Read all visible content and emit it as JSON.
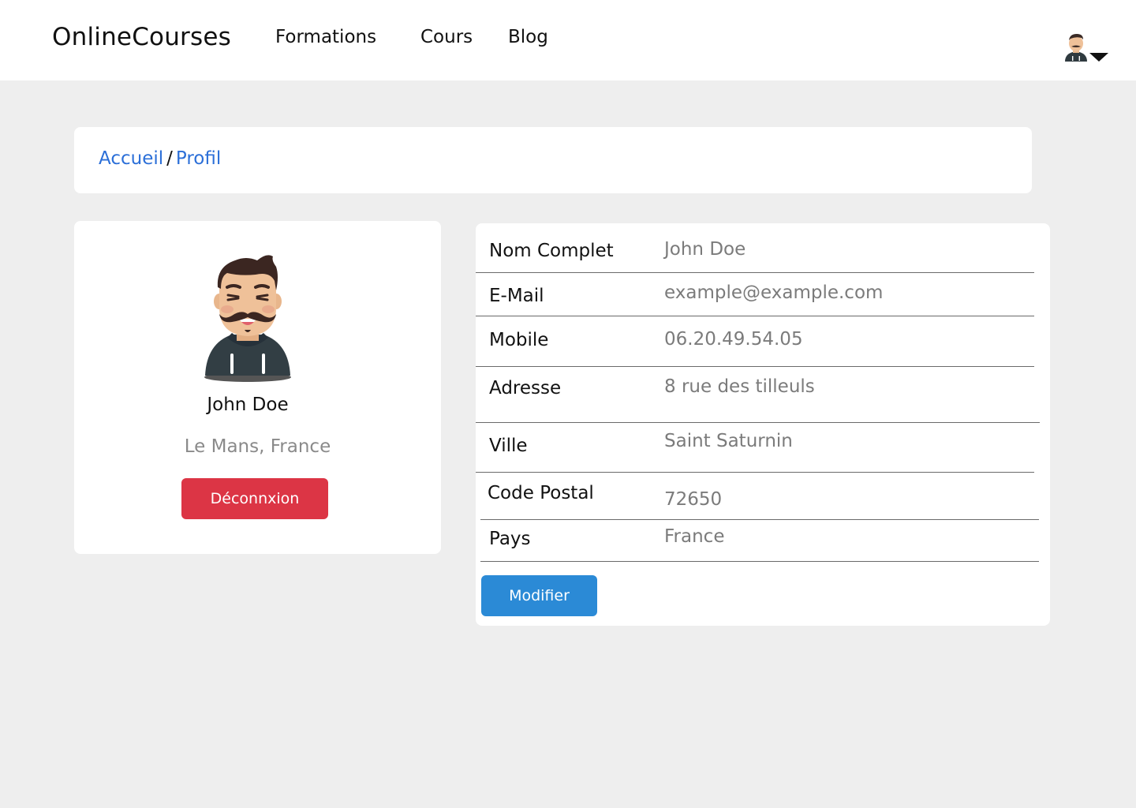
{
  "navbar": {
    "brand": "OnlineCourses",
    "links": [
      "Formations",
      "Cours",
      "Blog"
    ],
    "user_menu_icon": "user-avatar-icon",
    "dropdown_icon": "caret-down-icon"
  },
  "breadcrumb": {
    "home": "Accueil",
    "separator": "/",
    "current": "Profil"
  },
  "profile": {
    "name": "John Doe",
    "location": "Le Mans, France",
    "logout_label": "Déconnxion"
  },
  "details": {
    "rows": [
      {
        "label": "Nom Complet",
        "value": "John Doe"
      },
      {
        "label": "E-Mail",
        "value": "example@example.com"
      },
      {
        "label": "Mobile",
        "value": "06.20.49.54.05"
      },
      {
        "label": "Adresse",
        "value": "8 rue des tilleuls"
      },
      {
        "label": "Ville",
        "value": "Saint Saturnin"
      },
      {
        "label": "Code Postal",
        "value": "72650"
      },
      {
        "label": "Pays",
        "value": "France"
      }
    ],
    "modify_label": "Modifier"
  },
  "colors": {
    "page_background": "#eeeeee",
    "card_background": "#ffffff",
    "link": "#2b6fd8",
    "danger": "#dc3545",
    "primary": "#2b8ad6",
    "muted_text": "#7b7b7b"
  }
}
